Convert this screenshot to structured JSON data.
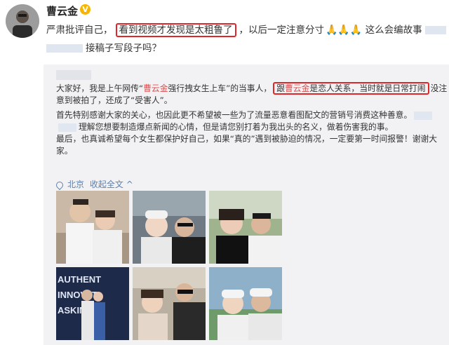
{
  "post": {
    "username": "曹云金",
    "verified_badge": "V",
    "text_part1": "严肃批评自己，",
    "text_highlight": "看到视频才发现是太粗鲁了",
    "text_part2": "，以后一定注意分寸",
    "emoji_hands": "🙏🙏🙏",
    "text_part3": "这么会编故事",
    "text_part4": "接稿子写段子吗？"
  },
  "repost": {
    "line1_a": "大家好，我是上午网传“",
    "line1_name": "曹云金",
    "line1_b": "强行拽女生上车”的当事人，",
    "line1_hl_a": "跟",
    "line1_hl_name": "曹云金",
    "line1_hl_b": "是恋人关系，当时就是日常打闹",
    "line1_c": "没注",
    "line2": "意到被拍了，还成了“受害人”。",
    "line3": "首先特别感谢大家的关心，也因此更不希望被一些为了流量恶意看图配文的营销号消费这种善意。",
    "line4": "理解您想要制造爆点新闻的心情，但是请您别打着为我出头的名义，做着伤害我的事。",
    "line5": "最后，也真诚希望每个女生都保护好自己，如果“真的”遇到被胁迫的情况，一定要第一时间报警！谢谢大",
    "line6": "家。",
    "location": "北京",
    "expand_label": "收起全文",
    "expand_arrow": "^"
  },
  "photos": [
    {
      "name": "photo-couple-white-shirts"
    },
    {
      "name": "photo-selfie-car-caps"
    },
    {
      "name": "photo-selfie-outdoor"
    },
    {
      "name": "photo-event-backdrop",
      "backdrop_text": [
        "AUTHENT",
        "INNOVATI",
        "ASKING"
      ]
    },
    {
      "name": "photo-group-sunglasses"
    },
    {
      "name": "photo-selfie-caps"
    }
  ],
  "colors": {
    "highlight_border": "#e1262a",
    "name_red": "#e14b4b",
    "link_blue": "#5a80b0",
    "repost_bg": "#f2f2f5"
  }
}
